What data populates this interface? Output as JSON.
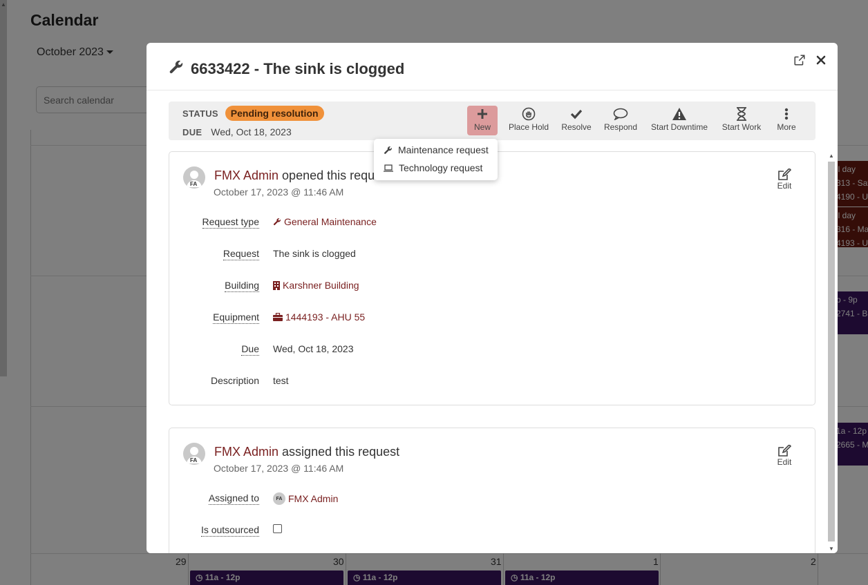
{
  "background": {
    "title": "Calendar",
    "month": "October 2023",
    "search_placeholder": "Search calendar",
    "day_numbers": [
      "29",
      "30",
      "31",
      "1",
      "2"
    ],
    "bottom_events": [
      "11a - 12p",
      "11a - 12p",
      "11a - 12p"
    ],
    "side_events": [
      {
        "lines": [
          "ll day",
          "313 - Saf",
          "4190 - Un"
        ]
      },
      {
        "lines": [
          "ll day",
          "316 - Ma",
          "4193 - Un"
        ]
      },
      {
        "lines": [
          "p - 9p",
          "2741 - Bu"
        ]
      },
      {
        "lines": [
          "1a - 12p",
          "2665 - Ma"
        ]
      }
    ]
  },
  "modal": {
    "title": "6633422 - The sink is clogged",
    "status_label": "STATUS",
    "status_value": "Pending resolution",
    "due_label": "DUE",
    "due_value": "Wed, Oct 18, 2023",
    "actions": {
      "new": "New",
      "place_hold": "Place Hold",
      "resolve": "Resolve",
      "respond": "Respond",
      "start_downtime": "Start Downtime",
      "start_work": "Start Work",
      "more": "More"
    },
    "new_menu": [
      "Maintenance request",
      "Technology request"
    ],
    "cards": [
      {
        "avatar_initials": "FA",
        "user": "FMX Admin",
        "action_text": "opened this request",
        "timestamp": "October 17, 2023 @ 11:46 AM",
        "edit_label": "Edit",
        "fields": {
          "request_type_label": "Request type",
          "request_type_value": "General Maintenance",
          "request_label": "Request",
          "request_value": "The sink is clogged",
          "building_label": "Building",
          "building_value": "Karshner Building",
          "equipment_label": "Equipment",
          "equipment_value": "1444193 - AHU 55",
          "due_label": "Due",
          "due_value": "Wed, Oct 18, 2023",
          "description_label": "Description",
          "description_value": "test"
        }
      },
      {
        "avatar_initials": "FA",
        "user": "FMX Admin",
        "action_text": "assigned this request",
        "timestamp": "October 17, 2023 @ 11:46 AM",
        "edit_label": "Edit",
        "fields": {
          "assigned_to_label": "Assigned to",
          "assigned_to_initials": "FA",
          "assigned_to_value": "FMX Admin",
          "is_outsourced_label": "Is outsourced",
          "is_outsourced_checked": false
        }
      }
    ]
  },
  "colors": {
    "accent": "#7a2121",
    "status_pill": "#f0913a",
    "new_button_active": "#dc9b9c",
    "event_purple": "#3b1460",
    "event_red": "#6b1a10"
  }
}
